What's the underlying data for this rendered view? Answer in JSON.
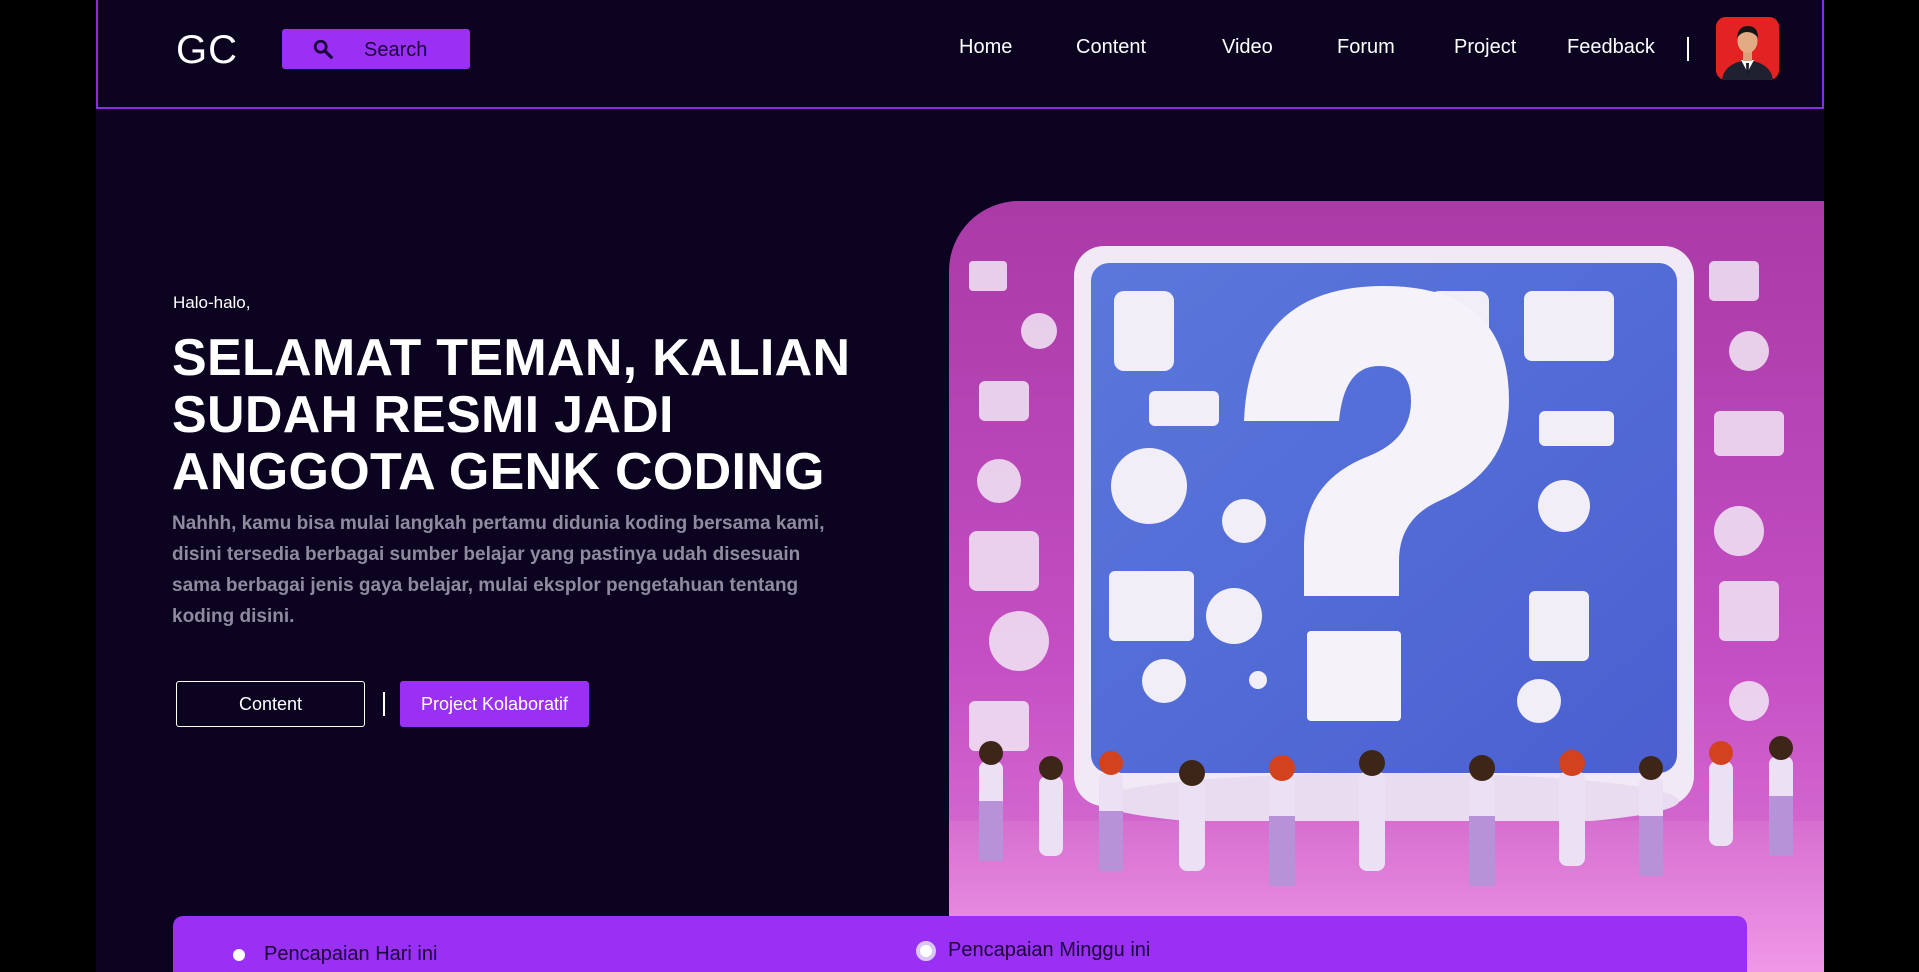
{
  "header": {
    "logo": "GC",
    "search_label": "Search",
    "nav": [
      "Home",
      "Content",
      "Video",
      "Forum",
      "Project",
      "Feedback"
    ]
  },
  "hero": {
    "greeting": "Halo-halo,",
    "headline": "SELAMAT TEMAN, KALIAN SUDAH RESMI JADI ANGGOTA GENK CODING",
    "description": "Nahhh, kamu bisa mulai langkah pertamu didunia koding bersama kami, disini tersedia berbagai sumber belajar yang pastinya udah disesuain sama berbagai jenis gaya belajar, mulai eksplor pengetahuan tentang koding disini.",
    "btn_content": "Content",
    "btn_project": "Project Kolaboratif"
  },
  "stats": {
    "today": "Pencapaian Hari ini",
    "week": "Pencapaian Minggu ini"
  },
  "colors": {
    "accent": "#9b30f5",
    "background": "#0b0320"
  },
  "icons": {
    "search": "search-icon",
    "avatar": "user-avatar"
  }
}
